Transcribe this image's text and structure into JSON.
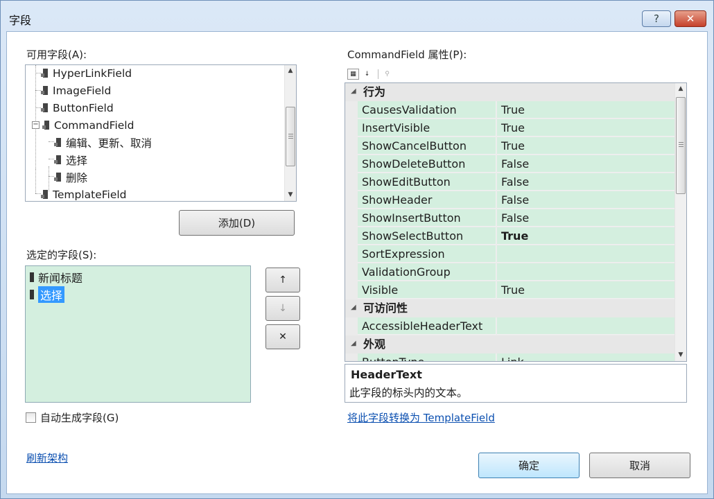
{
  "window": {
    "title": "字段",
    "help_label": "?",
    "close_label": "✕"
  },
  "available": {
    "label": "可用字段(A):",
    "items": [
      "HyperLinkField",
      "ImageField",
      "ButtonField",
      "CommandField",
      "编辑、更新、取消",
      "选择",
      "删除",
      "TemplateField"
    ],
    "add_button": "添加(D)"
  },
  "selected": {
    "label": "选定的字段(S):",
    "items": [
      "新闻标题",
      "选择"
    ],
    "up_label": "↑",
    "down_label": "↓",
    "delete_label": "✕"
  },
  "auto_generate": {
    "label": "自动生成字段(G)",
    "checked": false
  },
  "refresh_link": "刷新架构",
  "properties": {
    "label": "CommandField 属性(P):",
    "categories": [
      {
        "name": "行为",
        "rows": [
          {
            "name": "CausesValidation",
            "value": "True"
          },
          {
            "name": "InsertVisible",
            "value": "True"
          },
          {
            "name": "ShowCancelButton",
            "value": "True"
          },
          {
            "name": "ShowDeleteButton",
            "value": "False"
          },
          {
            "name": "ShowEditButton",
            "value": "False"
          },
          {
            "name": "ShowHeader",
            "value": "False"
          },
          {
            "name": "ShowInsertButton",
            "value": "False"
          },
          {
            "name": "ShowSelectButton",
            "value": "True"
          },
          {
            "name": "SortExpression",
            "value": ""
          },
          {
            "name": "ValidationGroup",
            "value": ""
          },
          {
            "name": "Visible",
            "value": "True"
          }
        ]
      },
      {
        "name": "可访问性",
        "rows": [
          {
            "name": "AccessibleHeaderText",
            "value": ""
          }
        ]
      },
      {
        "name": "外观",
        "rows": [
          {
            "name": "ButtonType",
            "value": "Link"
          }
        ]
      }
    ],
    "description_title": "HeaderText",
    "description_text": "此字段的标头内的文本。",
    "convert_link": "将此字段转换为 TemplateField"
  },
  "ok_button": "确定",
  "cancel_button": "取消",
  "colors": {
    "grid_green": "#d4efdf",
    "selection_blue": "#3399ff",
    "link_blue": "#0b4fb0"
  }
}
